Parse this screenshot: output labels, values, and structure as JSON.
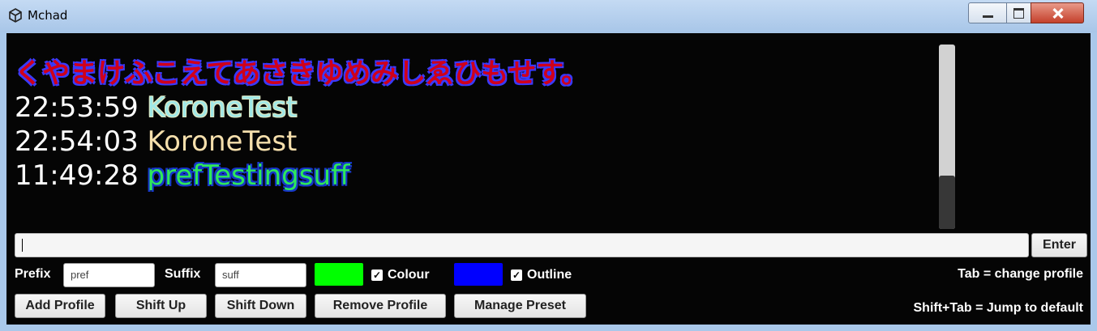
{
  "window": {
    "title": "Mchad",
    "icon": "unity-icon",
    "controls": [
      "minimize-icon",
      "maximize-icon",
      "close-icon"
    ]
  },
  "chat": {
    "lines": [
      {
        "text": "くやまけふこえてあさきゆめみしゑひもせす。"
      },
      {
        "time": "22:53:59",
        "name": "KoroneTest"
      },
      {
        "time": "22:54:03",
        "name": "KoroneTest"
      },
      {
        "time": "11:49:28",
        "name": "prefTestingsuff"
      }
    ],
    "scroll_position": 1.0
  },
  "input": {
    "value": "",
    "enter_label": "Enter"
  },
  "controls": {
    "prefix_label": "Prefix",
    "prefix_value": "pref",
    "suffix_label": "Suffix",
    "suffix_value": "suff",
    "colour_swatch": "#00ff00",
    "colour_label": "Colour",
    "colour_checked": true,
    "outline_swatch": "#0000ff",
    "outline_label": "Outline",
    "outline_checked": true
  },
  "buttons": {
    "add_profile": "Add Profile",
    "shift_up": "Shift Up",
    "shift_down": "Shift Down",
    "remove_profile": "Remove Profile",
    "manage_preset": "Manage Preset"
  },
  "hints": {
    "tab": "Tab = change profile",
    "shift_tab": "Shift+Tab = Jump to default"
  }
}
